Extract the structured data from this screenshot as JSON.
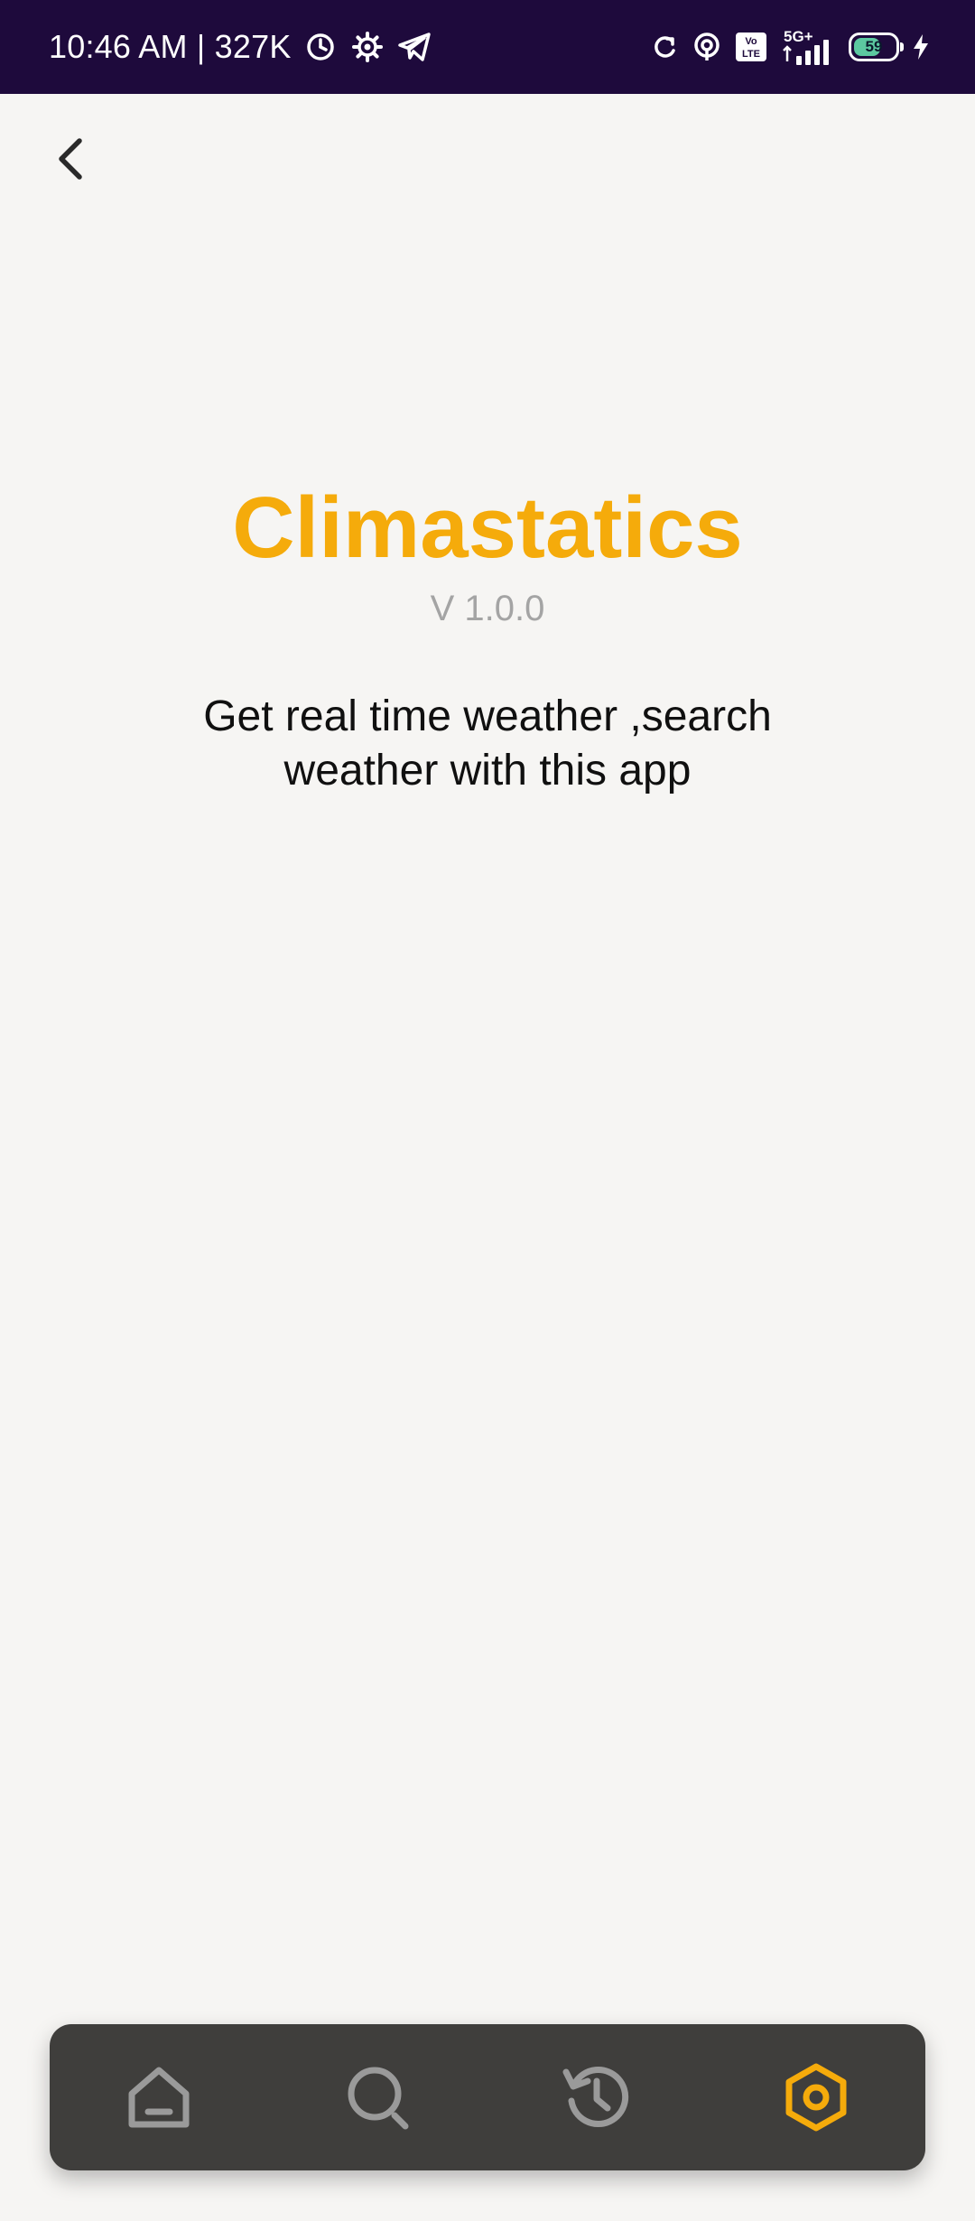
{
  "status_bar": {
    "time_text": "10:46 AM | 327K",
    "battery_level": "59",
    "network": "5G+",
    "icons": [
      "do-not-disturb-icon",
      "settings-gear-icon",
      "telegram-icon",
      "sync-icon",
      "hotspot-icon",
      "volte-icon",
      "signal-icon",
      "battery-icon",
      "charging-icon"
    ]
  },
  "header": {
    "back_icon": "chevron-left-icon"
  },
  "about": {
    "title": "Climastatics",
    "version": "V 1.0.0",
    "description": "Get real time weather ,search weather with this app"
  },
  "bottom_nav": {
    "items": [
      {
        "icon": "home-icon",
        "active": false
      },
      {
        "icon": "search-icon",
        "active": false
      },
      {
        "icon": "history-icon",
        "active": false
      },
      {
        "icon": "settings-icon",
        "active": true
      }
    ],
    "inactive_color": "#9a9a9a",
    "active_color": "#f5ab0b"
  },
  "colors": {
    "status_bar_bg": "#1e0a3c",
    "accent": "#f5ab0b",
    "background": "#f6f5f3",
    "nav_bg": "#3f3e3c"
  }
}
